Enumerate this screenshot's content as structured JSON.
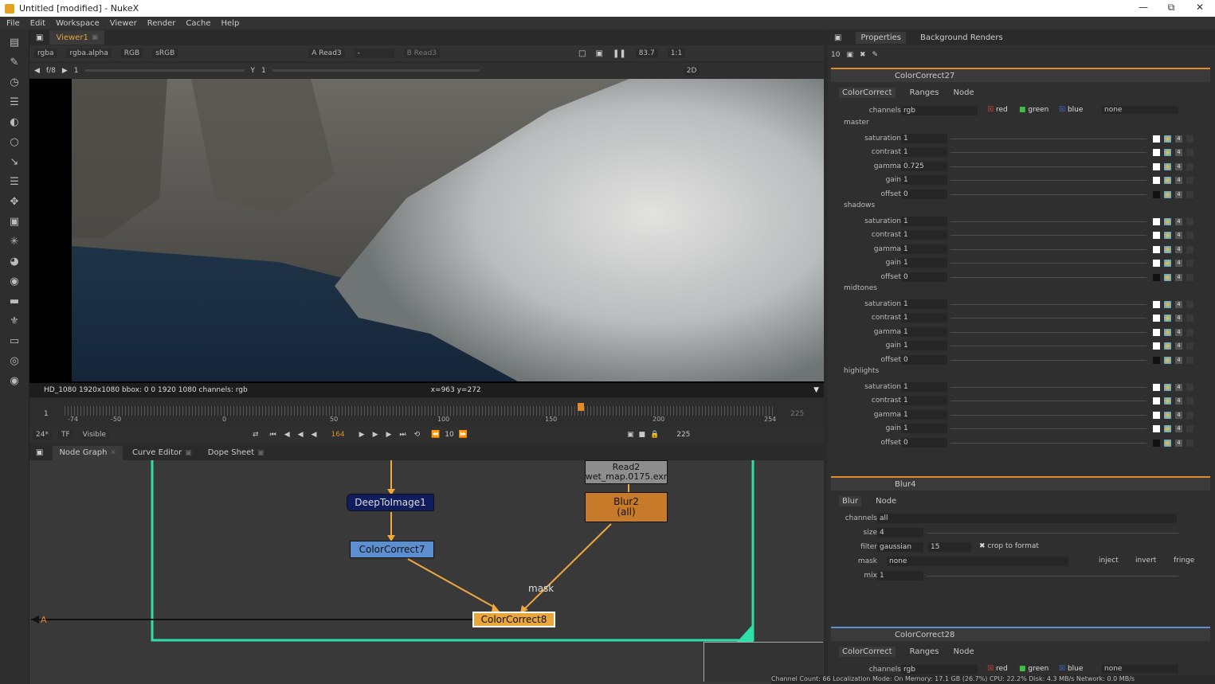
{
  "window": {
    "title": "Untitled [modified] - NukeX"
  },
  "menu": [
    "File",
    "Edit",
    "Workspace",
    "Viewer",
    "Render",
    "Cache",
    "Help"
  ],
  "viewer": {
    "tab": "Viewer1",
    "channels": "rgba",
    "alpha": "rgba.alpha",
    "colorspace": "RGB",
    "lut": "sRGB",
    "input_a": "A  Read3",
    "input_dash": "-",
    "input_b": "B  Read3",
    "zoom": "83.7",
    "ratio": "1:1",
    "mode": "2D",
    "frame_label": "f/8",
    "frame_value": "1",
    "y_label": "Y",
    "y_value": "1",
    "status": "HD_1080 1920x1080  bbox: 0 0 1920 1080 channels: rgb",
    "coords": "x=963 y=272"
  },
  "timeline": {
    "ticks": [
      "-74",
      "-50",
      "0",
      "50",
      "100",
      "150",
      "200",
      "254"
    ],
    "start_left": "1",
    "end_right": "225",
    "fps": "24*",
    "tf": "TF",
    "visible": "Visible",
    "current_frame": "164",
    "step": "10",
    "end_frame": "225"
  },
  "panel_tabs": [
    "Node Graph",
    "Curve Editor",
    "Dope Sheet"
  ],
  "nodes": {
    "deep": "DeepToImage1",
    "cc7": "ColorCorrect7",
    "read2_a": "Read2",
    "read2_b": "wet_map.0175.exr",
    "blur2_a": "Blur2",
    "blur2_b": "(all)",
    "cc8": "ColorCorrect8",
    "mask": "mask",
    "a_label": "A"
  },
  "properties": {
    "tabs": [
      "Properties",
      "Background Renders"
    ],
    "max_panels": "10",
    "cc27": {
      "name": "ColorCorrect27",
      "subtabs": [
        "ColorCorrect",
        "Ranges",
        "Node"
      ],
      "channels_label": "channels",
      "channels": "rgb",
      "red": "red",
      "green": "green",
      "blue": "blue",
      "extra": "none",
      "sections": [
        {
          "name": "master",
          "rows": [
            [
              "saturation",
              "1"
            ],
            [
              "contrast",
              "1"
            ],
            [
              "gamma",
              "0.725"
            ],
            [
              "gain",
              "1"
            ],
            [
              "offset",
              "0"
            ]
          ]
        },
        {
          "name": "shadows",
          "rows": [
            [
              "saturation",
              "1"
            ],
            [
              "contrast",
              "1"
            ],
            [
              "gamma",
              "1"
            ],
            [
              "gain",
              "1"
            ],
            [
              "offset",
              "0"
            ]
          ]
        },
        {
          "name": "midtones",
          "rows": [
            [
              "saturation",
              "1"
            ],
            [
              "contrast",
              "1"
            ],
            [
              "gamma",
              "1"
            ],
            [
              "gain",
              "1"
            ],
            [
              "offset",
              "0"
            ]
          ]
        },
        {
          "name": "highlights",
          "rows": [
            [
              "saturation",
              "1"
            ],
            [
              "contrast",
              "1"
            ],
            [
              "gamma",
              "1"
            ],
            [
              "gain",
              "1"
            ],
            [
              "offset",
              "0"
            ]
          ]
        }
      ]
    },
    "blur4": {
      "name": "Blur4",
      "subtabs": [
        "Blur",
        "Node"
      ],
      "channels_label": "channels",
      "channels": "all",
      "size_label": "size",
      "size": "4",
      "filter_label": "filter",
      "filter": "gaussian",
      "quality": "15",
      "crop": "crop to format",
      "mask_label": "mask",
      "mask": "none",
      "inject": "inject",
      "invert": "invert",
      "fringe": "fringe",
      "mix_label": "mix",
      "mix": "1"
    },
    "cc28": {
      "name": "ColorCorrect28",
      "subtabs": [
        "ColorCorrect",
        "Ranges",
        "Node"
      ],
      "channels_label": "channels",
      "channels": "rgb",
      "red": "red",
      "green": "green",
      "blue": "blue",
      "extra": "none"
    }
  },
  "statusbar": "Channel Count: 66  Localization Mode: On  Memory: 17.1 GB (26.7%)  CPU: 22.2%  Disk: 4.3 MB/s  Network: 0.0 MB/s",
  "colors": {
    "accent": "#e08a28",
    "cc_node": "#5b8fd0",
    "blur_node": "#c77a2a",
    "deep_node": "#0f1d5e",
    "backdrop": "#2ee0a8"
  }
}
